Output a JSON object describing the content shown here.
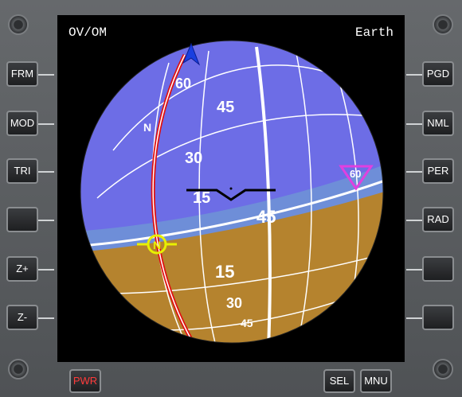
{
  "display": {
    "mode_label": "OV/OM",
    "body_label": "Earth"
  },
  "buttons_left": [
    {
      "label": "FRM"
    },
    {
      "label": "MOD"
    },
    {
      "label": "TRI"
    },
    {
      "label": ""
    },
    {
      "label": "Z+"
    },
    {
      "label": "Z-"
    }
  ],
  "buttons_right": [
    {
      "label": "PGD"
    },
    {
      "label": "NML"
    },
    {
      "label": "PER"
    },
    {
      "label": "RAD"
    },
    {
      "label": ""
    },
    {
      "label": ""
    }
  ],
  "buttons_bottom": {
    "pwr": "PWR",
    "sel": "SEL",
    "mnu": "MNU"
  },
  "ball": {
    "sky_color": "#6d6de6",
    "ground_color": "#b5832e",
    "horizon_band_color": "#6e8ed8",
    "horizon_label": "45",
    "lat_labels_upper": [
      "60",
      "45",
      "30",
      "15"
    ],
    "lat_labels_lower": [
      "15",
      "30",
      "45"
    ],
    "north_meridian_label": "N",
    "north_marker_label": "N",
    "retrograde_marker_label": "60"
  },
  "colors": {
    "prograde_marker": "#1a3fe0",
    "north_marker": "#e8f000",
    "retrograde_marker": "#e040e0",
    "meridian_red": "#e01010",
    "pwr_text": "#ff3b3b"
  }
}
